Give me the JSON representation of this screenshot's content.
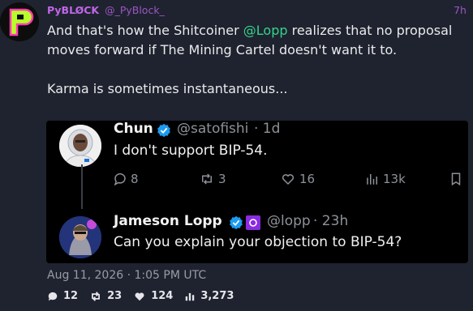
{
  "post": {
    "author_name": "PyBLØCK",
    "author_handle": "@_PyBlock_",
    "time_ago": "7h",
    "text_before_mention": "And that's how the Shitcoiner ",
    "mention": "@Lopp",
    "text_after_mention": " realizes that no proposal moves forward if The Mining Cartel doesn't want it to.\n\nKarma is sometimes instantaneous...",
    "timestamp": "Aug 11, 2026 · 1:05 PM UTC"
  },
  "stats": {
    "replies": "12",
    "reposts": "23",
    "likes": "124",
    "views": "3,273"
  },
  "quoted": {
    "first": {
      "name": "Chun",
      "handle": "@satofishi",
      "time": "· 1d",
      "text": "I don't support BIP-54.",
      "replies": "8",
      "reposts": "3",
      "likes": "16",
      "views": "13k"
    },
    "second": {
      "name": "Jameson Lopp",
      "handle": "@lopp",
      "time": "· 23h",
      "text": "Can you explain your objection to BIP-54?"
    }
  },
  "colors": {
    "background": "#1f2330",
    "accent_purple": "#c066e8",
    "mention_green": "#34d48a",
    "verified_blue": "#1d9bf0"
  },
  "icons": [
    "pyblock-logo-icon",
    "verified-badge-icon",
    "affiliate-badge-icon",
    "reply-icon",
    "repost-icon",
    "like-icon",
    "views-icon",
    "bookmark-icon"
  ]
}
